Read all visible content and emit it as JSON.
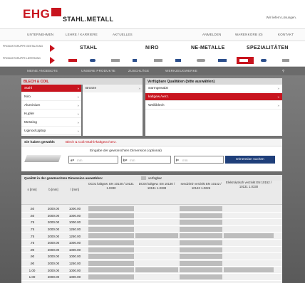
{
  "header": {
    "logo_text": "EHG",
    "logo_sub": "STAHL.METALL",
    "slogan": "Wir liefern Lösungen."
  },
  "nav": {
    "left": [
      "UNTERNEHMEN",
      "LEHRE / KARRIERE",
      "AKTUELLES"
    ],
    "right": [
      "ANMELDEN",
      "WARENKORB (0)",
      "KONTAKT"
    ]
  },
  "categories": {
    "row1_label": "PRODUKTGRUPPE GESTALTUNG",
    "row2_label": "PRODUKTGRUPPE LIEFERUNG",
    "tabs": [
      "STAHL",
      "NIRO",
      "NE-METALLE",
      "SPEZIALITÄTEN"
    ]
  },
  "subnav": [
    "MEINE ANGEBOTE",
    "UNSERE PRODUKTE",
    "ZUSCHLÄGE",
    "WERKZEUGWERKE"
  ],
  "left_panel": {
    "title": "BLECH & COIL",
    "items": [
      "Stahl",
      "Niro",
      "Aluminium",
      "Kupfer",
      "Messing",
      "Uginox/Ugitop"
    ],
    "selected_index": 0
  },
  "middle_panel": {
    "items": [
      "Bronze"
    ]
  },
  "right_panel": {
    "title": "Verfügbare Qualitäten (bitte auswählen)",
    "items": [
      "warmgewalzt",
      "kaltgew./verz.",
      "Weißblech"
    ],
    "selected_index": 1
  },
  "selection": {
    "label": "Sie haben gewählt:",
    "value": "Blech & Coil>Stahl>kaltgew./verz."
  },
  "dimension": {
    "label": "Eingabe der gewünschten Dimension (optional)",
    "inputs": [
      {
        "prefix": "s=",
        "placeholder": "mm"
      },
      {
        "prefix": "b=",
        "placeholder": "mm"
      },
      {
        "prefix": "l=",
        "placeholder": "mm"
      }
    ],
    "button": "Dimension suchen"
  },
  "results": {
    "title": "Qualität in der gewünschten Dimension auswählen:",
    "legend": "verfügbar"
  },
  "table": {
    "headers": [
      "s [mm]",
      "b [mm]",
      "l [mm]",
      "DC01 kaltgew. EN 10130 / 10131 1.0330",
      "DC04 kaltgew. EN 10130 / 10131 1.0338",
      "sendzimir verzinkt EN 10142 / 10143 1.0226",
      "Elektrolytisch verzinkt EN 10152 / 10131 1.0330"
    ],
    "rows": [
      {
        "s": ".50",
        "b": "2000.00",
        "l": "1000.00",
        "avail": [
          true,
          false,
          true,
          false
        ]
      },
      {
        "s": ".60",
        "b": "2000.00",
        "l": "1000.00",
        "avail": [
          true,
          false,
          true,
          false
        ]
      },
      {
        "s": ".75",
        "b": "2000.00",
        "l": "1000.00",
        "avail": [
          true,
          false,
          true,
          false
        ]
      },
      {
        "s": ".75",
        "b": "2000.00",
        "l": "1250.00",
        "avail": [
          true,
          false,
          true,
          false
        ]
      },
      {
        "s": ".75",
        "b": "2000.00",
        "l": "1250.00",
        "avail": [
          true,
          true,
          true,
          true
        ]
      },
      {
        "s": ".75",
        "b": "2000.00",
        "l": "1000.00",
        "avail": [
          true,
          false,
          true,
          false
        ]
      },
      {
        "s": ".90",
        "b": "2000.00",
        "l": "1000.00",
        "avail": [
          true,
          false,
          true,
          false
        ]
      },
      {
        "s": ".90",
        "b": "2000.00",
        "l": "1000.00",
        "avail": [
          true,
          false,
          true,
          false
        ]
      },
      {
        "s": ".90",
        "b": "2000.00",
        "l": "1250.00",
        "avail": [
          true,
          false,
          true,
          false
        ]
      },
      {
        "s": "1.00",
        "b": "2000.00",
        "l": "1000.00",
        "avail": [
          true,
          true,
          true,
          true
        ]
      },
      {
        "s": "1.00",
        "b": "2000.00",
        "l": "1000.00",
        "avail": [
          true,
          false,
          true,
          false
        ]
      }
    ]
  },
  "colors": {
    "brand_red": "#c8141e",
    "button_blue": "#1f3f7a",
    "available_grey": "#bdbdbd"
  }
}
